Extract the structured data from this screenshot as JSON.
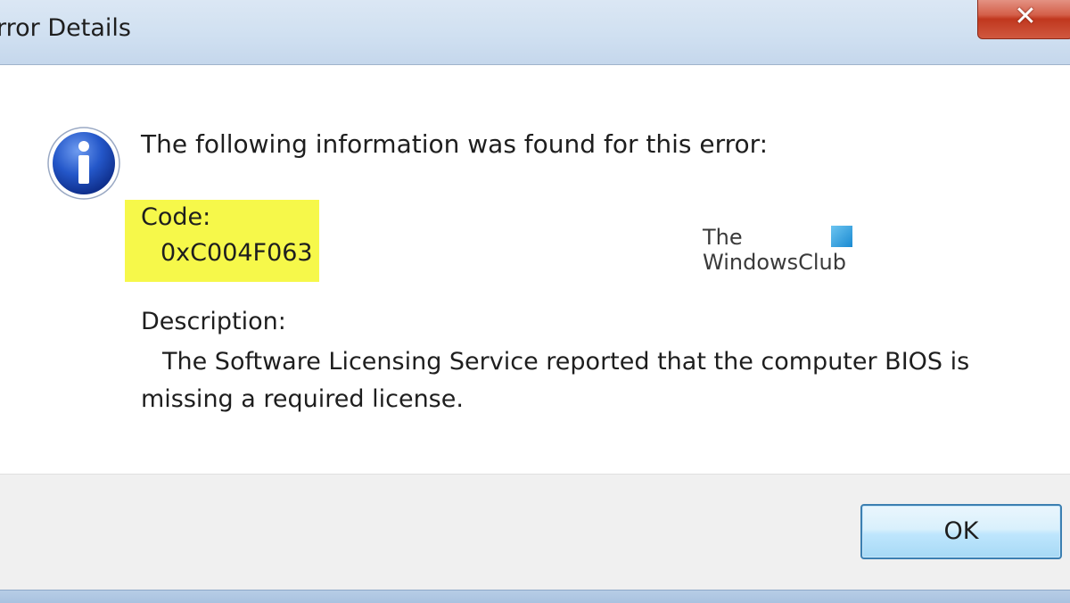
{
  "window": {
    "title": "rror Details",
    "close_glyph": "✕"
  },
  "message": {
    "heading": "The following information was found for this error:",
    "code_label": "Code:",
    "code_value": "0xC004F063",
    "description_label": "Description:",
    "description_text": "The Software Licensing Service reported that the computer BIOS is missing a required license."
  },
  "watermark": {
    "line1": "The",
    "line2": "WindowsClub"
  },
  "buttons": {
    "ok_label": "OK"
  },
  "colors": {
    "highlight": "#f6f84a",
    "info_icon_blue": "#1c4fbf",
    "close_red": "#c0371e"
  }
}
